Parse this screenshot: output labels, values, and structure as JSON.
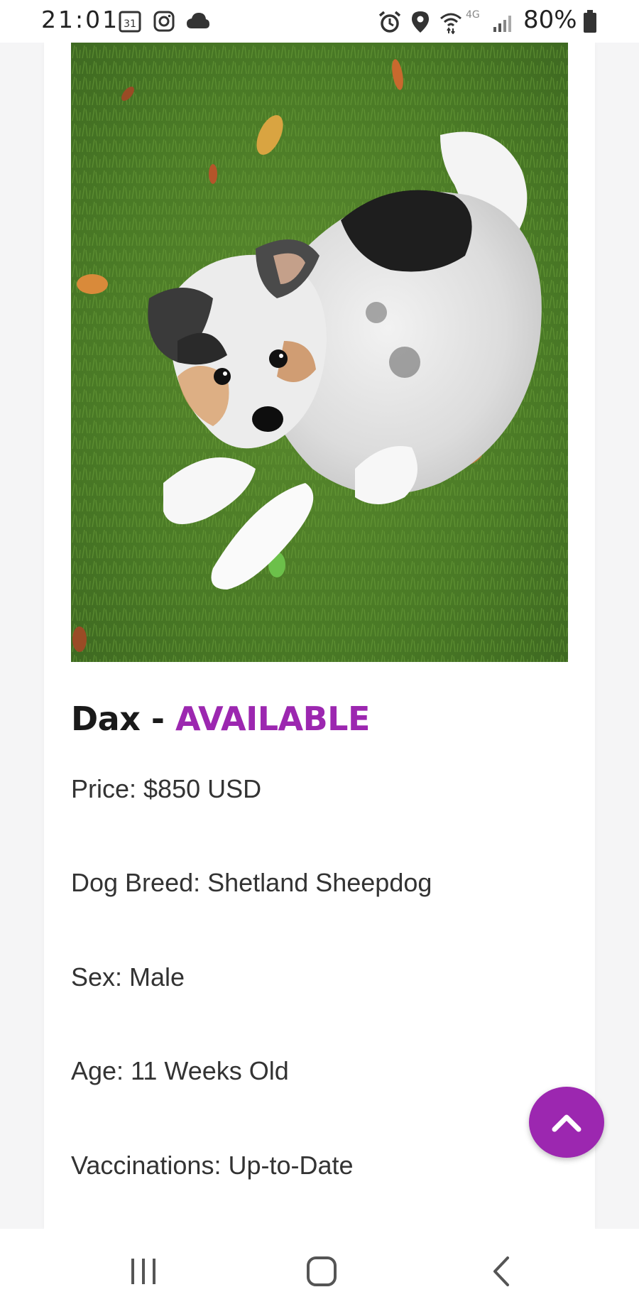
{
  "status_bar": {
    "time": "21:01",
    "calendar_day": "31",
    "network": "4G",
    "battery": "80%",
    "icons": [
      "calendar-icon",
      "instagram-icon",
      "cloud-icon",
      "alarm-icon",
      "location-icon",
      "wifi-icon",
      "signal-icon",
      "battery-icon"
    ]
  },
  "listing": {
    "photo_icon": "puppy-photo",
    "name": "Dax",
    "separator": " - ",
    "status": "AVAILABLE",
    "details": [
      "Price: $850 USD",
      "Dog Breed: Shetland Sheepdog",
      "Sex: Male",
      "Age: 11 Weeks Old",
      "Vaccinations: Up-to-Date"
    ]
  },
  "scroll_top": {
    "icon": "chevron-up-icon"
  },
  "nav_bar": {
    "icons": [
      "recents-icon",
      "home-icon",
      "back-icon"
    ]
  },
  "colors": {
    "accent": "#9c27b0",
    "title": "#1a1a1a",
    "text": "#333333",
    "page_bg": "#f5f5f6"
  }
}
